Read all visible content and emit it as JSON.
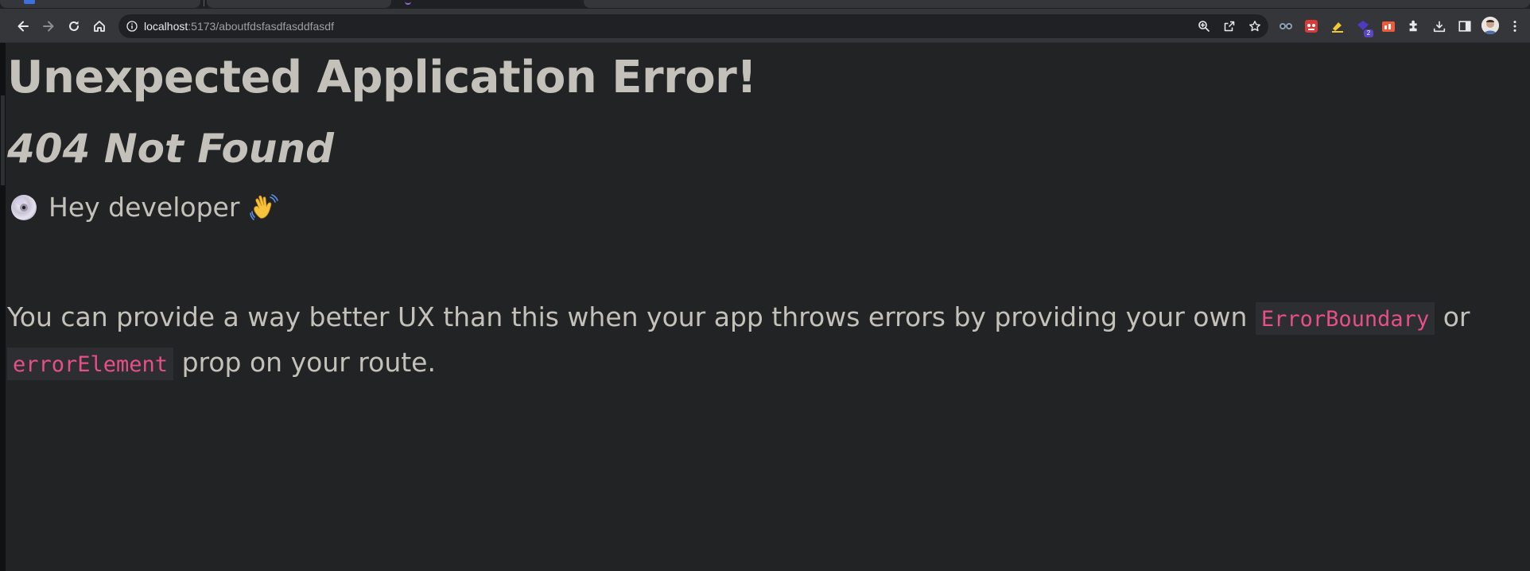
{
  "browser": {
    "url_host": "localhost",
    "url_path": ":5173/aboutfdsfasdfasddfasdf",
    "extension_badge": "2",
    "icons": [
      "back-icon",
      "forward-icon",
      "reload-icon",
      "home-icon",
      "info-icon",
      "zoom-icon",
      "share-icon",
      "star-icon",
      "extensions-icon",
      "download-icon",
      "side-panel-icon",
      "menu-icon"
    ]
  },
  "error_page": {
    "title": "Unexpected Application Error!",
    "status": "404 Not Found",
    "hey_text": "Hey developer",
    "message_part1": "You can provide a way better UX than this when your app throws errors by providing your own",
    "code1": "ErrorBoundary",
    "message_part2": "or",
    "code2": "errorElement",
    "message_part3": "prop on your route."
  },
  "colors": {
    "background": "#222325",
    "text": "#c4c1ba",
    "code_text": "#e64f8a",
    "code_background": "#2d2e31"
  }
}
